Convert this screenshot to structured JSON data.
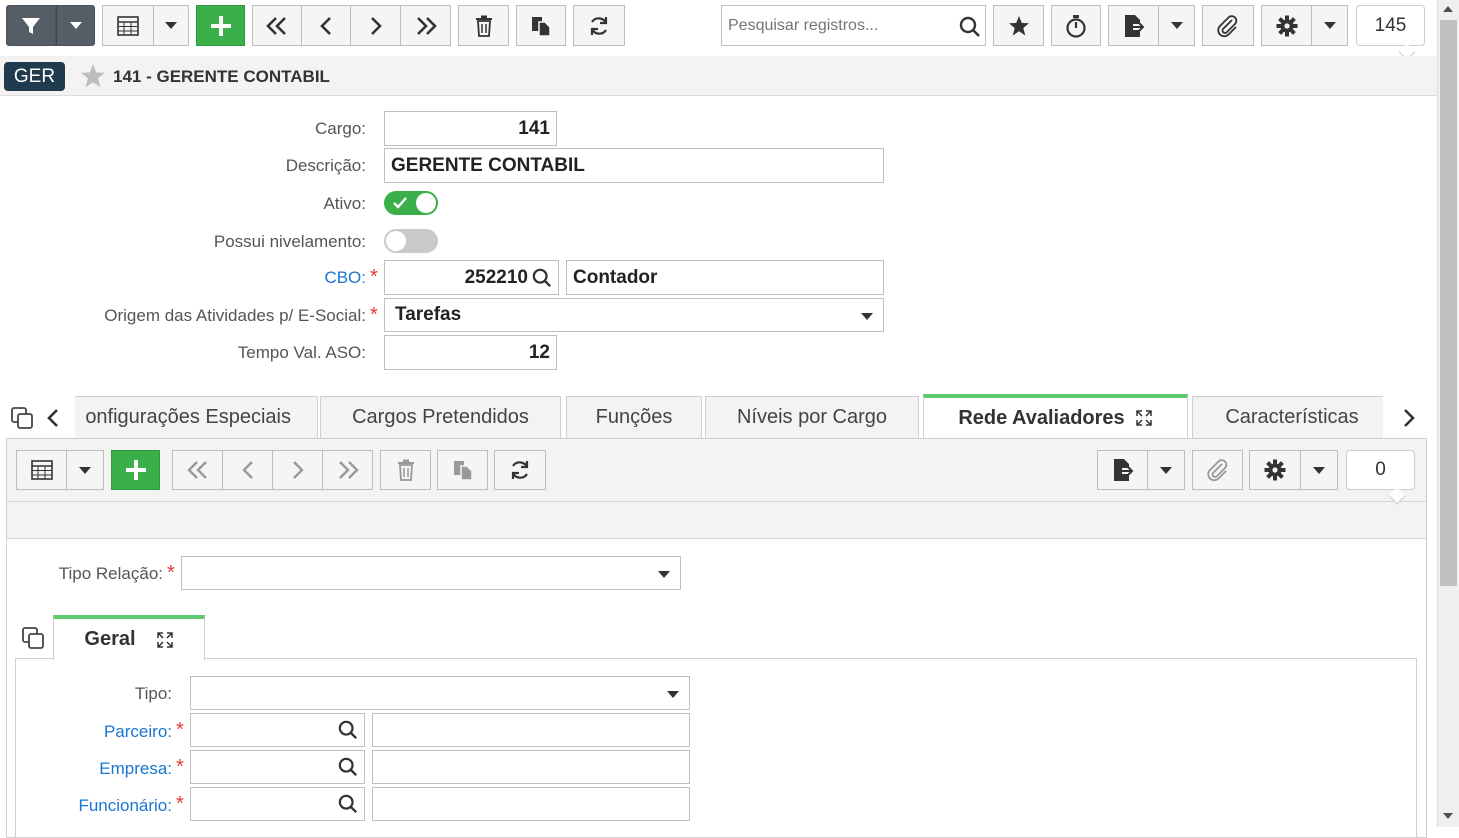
{
  "toolbar": {
    "search_placeholder": "Pesquisar registros...",
    "record_count": "145"
  },
  "header": {
    "badge": "GER",
    "title": "141 - GERENTE CONTABIL"
  },
  "form": {
    "cargo_label": "Cargo:",
    "cargo_value": "141",
    "descricao_label": "Descrição:",
    "descricao_value": "GERENTE CONTABIL",
    "ativo_label": "Ativo:",
    "ativo_checked": true,
    "nivelamento_label": "Possui nivelamento:",
    "nivelamento_checked": false,
    "cbo_label": "CBO:",
    "cbo_code": "252210",
    "cbo_desc": "Contador",
    "origem_label": "Origem das Atividades p/ E-Social:",
    "origem_value": "Tarefas",
    "tempo_label": "Tempo Val. ASO:",
    "tempo_value": "12",
    "required_mark": "*"
  },
  "tabs": [
    {
      "label": "onfigurações Especiais"
    },
    {
      "label": "Cargos Pretendidos"
    },
    {
      "label": "Funções"
    },
    {
      "label": "Níveis por Cargo"
    },
    {
      "label": "Rede Avaliadores",
      "active": true
    },
    {
      "label": "Características"
    }
  ],
  "subtoolbar": {
    "record_count": "0"
  },
  "detail": {
    "tipo_relacao_label": "Tipo Relação:",
    "tipo_relacao_value": "",
    "section_tab": "Geral",
    "tipo_label": "Tipo:",
    "tipo_value": "",
    "parceiro_label": "Parceiro:",
    "empresa_label": "Empresa:",
    "funcionario_label": "Funcionário:"
  },
  "colors": {
    "accent_green": "#3aaf4a",
    "link_blue": "#1a76d2",
    "required_red": "#e53935",
    "badge_bg": "#1f3b4d"
  }
}
